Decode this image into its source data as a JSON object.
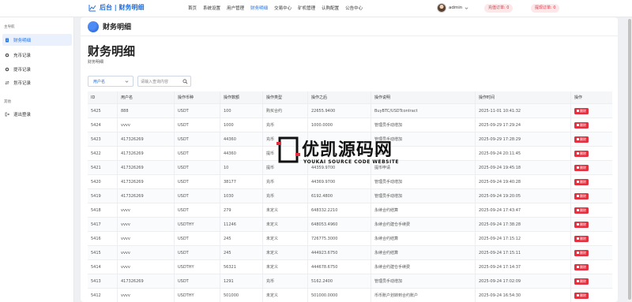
{
  "brand": {
    "title": "后台 | 财务明细"
  },
  "nav": [
    "首页",
    "系统设置",
    "用户管理",
    "财务明细",
    "交易中心",
    "矿机管理",
    "认购配置",
    "公告中心"
  ],
  "nav_active_index": 3,
  "user": {
    "name": "admin",
    "recharge_badge": "充值订单: 0",
    "withdraw_badge": "提现订单: 0"
  },
  "sidebar": {
    "section_main": "主导航",
    "items": [
      {
        "label": "财务明细",
        "icon": "document-icon",
        "active": true
      },
      {
        "label": "充币记录",
        "icon": "circle-icon",
        "active": false
      },
      {
        "label": "提币记录",
        "icon": "circle-icon",
        "active": false
      },
      {
        "label": "划币记录",
        "icon": "swap-icon",
        "active": false
      }
    ],
    "section_other": "其他",
    "logout_label": "退出登录"
  },
  "page": {
    "header_title": "财务明细",
    "title": "财务明细",
    "subtitle": "财务明细"
  },
  "filter": {
    "select_value": "用户名",
    "search_placeholder": "请输入查询内容"
  },
  "table": {
    "columns": [
      "ID",
      "用户名",
      "操作币种",
      "操作数额",
      "操作类型",
      "操作之后",
      "操作说明",
      "操作时间",
      "操作"
    ],
    "delete_label": "删除",
    "rows": [
      [
        "5425",
        "888",
        "USDT",
        "100",
        "购买合约",
        "22655.9400",
        "BuyBTC/USDTcontract",
        "2025-11-01 10:41:32"
      ],
      [
        "5424",
        "vvvv",
        "USDT",
        "1000",
        "充币",
        "1000.0000",
        "管理员手动增加",
        "2025-09-29 17:29:24"
      ],
      [
        "5423",
        "417326269",
        "USDT",
        "44360",
        "充币",
        "",
        "管理员手动增加",
        "2025-09-29 17:28:29"
      ],
      [
        "5422",
        "417326269",
        "USDT",
        "44360",
        "提币",
        "",
        "提币申请",
        "2025-09-24 20:11:45"
      ],
      [
        "5421",
        "417326269",
        "USDT",
        "10",
        "提币",
        "44359.9700",
        "提币申请",
        "2025-09-24 19:45:18"
      ],
      [
        "5420",
        "417326269",
        "USDT",
        "38177",
        "充币",
        "44369.9700",
        "管理员手动增加",
        "2025-09-24 19:40:28"
      ],
      [
        "5419",
        "417326269",
        "USDT",
        "1030",
        "充币",
        "6192.4800",
        "管理员手动增加",
        "2025-09-24 19:20:05"
      ],
      [
        "5418",
        "vvvv",
        "USDT",
        "279",
        "未定义",
        "648332.2210",
        "永续合约结算",
        "2025-09-24 17:43:47"
      ],
      [
        "5417",
        "vvvv",
        "USDTHY",
        "11246",
        "未定义",
        "648053.4960",
        "永续合约建仓手续费",
        "2025-09-24 17:38:28"
      ],
      [
        "5416",
        "vvvv",
        "USDT",
        "245",
        "未定义",
        "726775.3000",
        "永续合约结算",
        "2025-09-24 17:15:12"
      ],
      [
        "5415",
        "vvvv",
        "USDT",
        "245",
        "未定义",
        "444923.6750",
        "永续合约结算",
        "2025-09-24 17:15:11"
      ],
      [
        "5414",
        "vvvv",
        "USDTHY",
        "56321",
        "未定义",
        "444678.6750",
        "永续合约建仓手续费",
        "2025-09-24 17:14:37"
      ],
      [
        "5413",
        "417326269",
        "USDT",
        "1291",
        "充币",
        "5162.2400",
        "管理员手动增加",
        "2025-09-24 17:02:09"
      ],
      [
        "5412",
        "vvvv",
        "USDTHY",
        "501000",
        "未定义",
        "501000.0000",
        "币币账户划转到合约账户",
        "2025-09-24 16:54:30"
      ]
    ]
  },
  "watermark": {
    "main": "优凯源码网",
    "sub": "YOUKAI SOURCE CODE WEBSITE"
  },
  "colors": {
    "accent": "#1f6fe0",
    "danger": "#e7303f",
    "badge_bg": "#fde7e9"
  }
}
